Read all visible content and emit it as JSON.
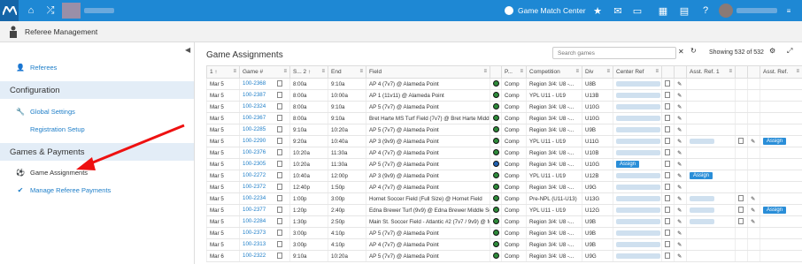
{
  "topbar": {
    "center_label": "Game Match Center"
  },
  "subbar": {
    "title": "Referee Management"
  },
  "sidebar": {
    "referees": "Referees",
    "configuration": "Configuration",
    "global_settings": "Global Settings",
    "registration_setup": "Registration Setup",
    "games_payments": "Games & Payments",
    "game_assignments": "Game Assignments",
    "manage_payments": "Manage Referee Payments"
  },
  "main": {
    "title": "Game Assignments",
    "search_placeholder": "Search games",
    "showing": "Showing 532 of 532"
  },
  "table": {
    "headers": [
      "1 ↑",
      "Game #",
      "S... 2 ↑",
      "End",
      "Field",
      "",
      "P...",
      "Competition",
      "Div",
      "Center Ref",
      "",
      "",
      "Asst. Ref. 1",
      "",
      "",
      "Asst. Ref."
    ],
    "assign_label": "Assign",
    "rows": [
      [
        "Mar 5",
        "100-2368",
        "8:00a",
        "9:10a",
        "AP 4 (7v7) @ Alameda Point",
        "g",
        "Comp",
        "Region 3/4: U8 -...",
        "U8B",
        "",
        "",
        ""
      ],
      [
        "Mar 5",
        "100-2387",
        "8:00a",
        "10:00a",
        "AP 1 (11v11) @ Alameda Point",
        "g",
        "Comp",
        "YPL U11 - U19",
        "U13B",
        "",
        "",
        ""
      ],
      [
        "Mar 5",
        "100-2324",
        "8:00a",
        "9:10a",
        "AP 5 (7v7) @ Alameda Point",
        "g",
        "Comp",
        "Region 3/4: U8 -...",
        "U10G",
        "",
        "",
        ""
      ],
      [
        "Mar 5",
        "100-2367",
        "8:00a",
        "9:10a",
        "Bret Harte MS Turf Field (7v7) @ Bret Harte Middl...",
        "g",
        "Comp",
        "Region 3/4: U8 -...",
        "U10G",
        "",
        "",
        ""
      ],
      [
        "Mar 5",
        "100-2285",
        "9:10a",
        "10:20a",
        "AP 5 (7v7) @ Alameda Point",
        "g",
        "Comp",
        "Region 3/4: U8 -...",
        "U9B",
        "",
        "",
        ""
      ],
      [
        "Mar 5",
        "100-2290",
        "9:20a",
        "10:40a",
        "AP 3 (9v9) @ Alameda Point",
        "g",
        "Comp",
        "YPL U11 - U19",
        "U11G",
        "",
        "",
        "x"
      ],
      [
        "Mar 5",
        "100-2376",
        "10:20a",
        "11:30a",
        "AP 4 (7v7) @ Alameda Point",
        "g",
        "Comp",
        "Region 3/4: U8 -...",
        "U10B",
        "",
        "",
        ""
      ],
      [
        "Mar 5",
        "100-2305",
        "10:20a",
        "11:30a",
        "AP 5 (7v7) @ Alameda Point",
        "b",
        "Comp",
        "Region 3/4: U8 -...",
        "U10G",
        "a",
        "",
        ""
      ],
      [
        "Mar 5",
        "100-2272",
        "10:40a",
        "12:00p",
        "AP 3 (9v9) @ Alameda Point",
        "g",
        "Comp",
        "YPL U11 - U19",
        "U12B",
        "",
        "a",
        ""
      ],
      [
        "Mar 5",
        "100-2372",
        "12:40p",
        "1:50p",
        "AP 4 (7v7) @ Alameda Point",
        "g",
        "Comp",
        "Region 3/4: U8 -...",
        "U9G",
        "",
        "",
        ""
      ],
      [
        "Mar 5",
        "100-2234",
        "1:00p",
        "3:00p",
        "Hornet Soccer Field (Full Size) @ Hornet Field",
        "g",
        "Comp",
        "Pre-NPL (U11-U13)",
        "U13G",
        "",
        "",
        ""
      ],
      [
        "Mar 5",
        "100-2377",
        "1:20p",
        "2:40p",
        "Edna Brewer Turf (9v9) @ Edna Brewer Middle Sch...",
        "g",
        "Comp",
        "YPL U11 - U19",
        "U12G",
        "",
        "",
        "x"
      ],
      [
        "Mar 5",
        "100-2284",
        "1:30p",
        "2:50p",
        "Main St. Soccer Field - Atlantic #2 (7v7 / 9v9) @ M...",
        "g",
        "Comp",
        "Region 3/4: U8 -...",
        "U9B",
        "",
        "",
        ""
      ],
      [
        "Mar 5",
        "100-2373",
        "3:00p",
        "4:10p",
        "AP 5 (7v7) @ Alameda Point",
        "g",
        "Comp",
        "Region 3/4: U8 -...",
        "U9B",
        "",
        "",
        ""
      ],
      [
        "Mar 5",
        "100-2313",
        "3:00p",
        "4:10p",
        "AP 4 (7v7) @ Alameda Point",
        "g",
        "Comp",
        "Region 3/4: U8 -...",
        "U9B",
        "",
        "",
        ""
      ],
      [
        "Mar 6",
        "100-2322",
        "9:10a",
        "10:20a",
        "AP 5 (7v7) @ Alameda Point",
        "g",
        "Comp",
        "Region 3/4: U8 -...",
        "U9G",
        "",
        "",
        ""
      ]
    ]
  }
}
